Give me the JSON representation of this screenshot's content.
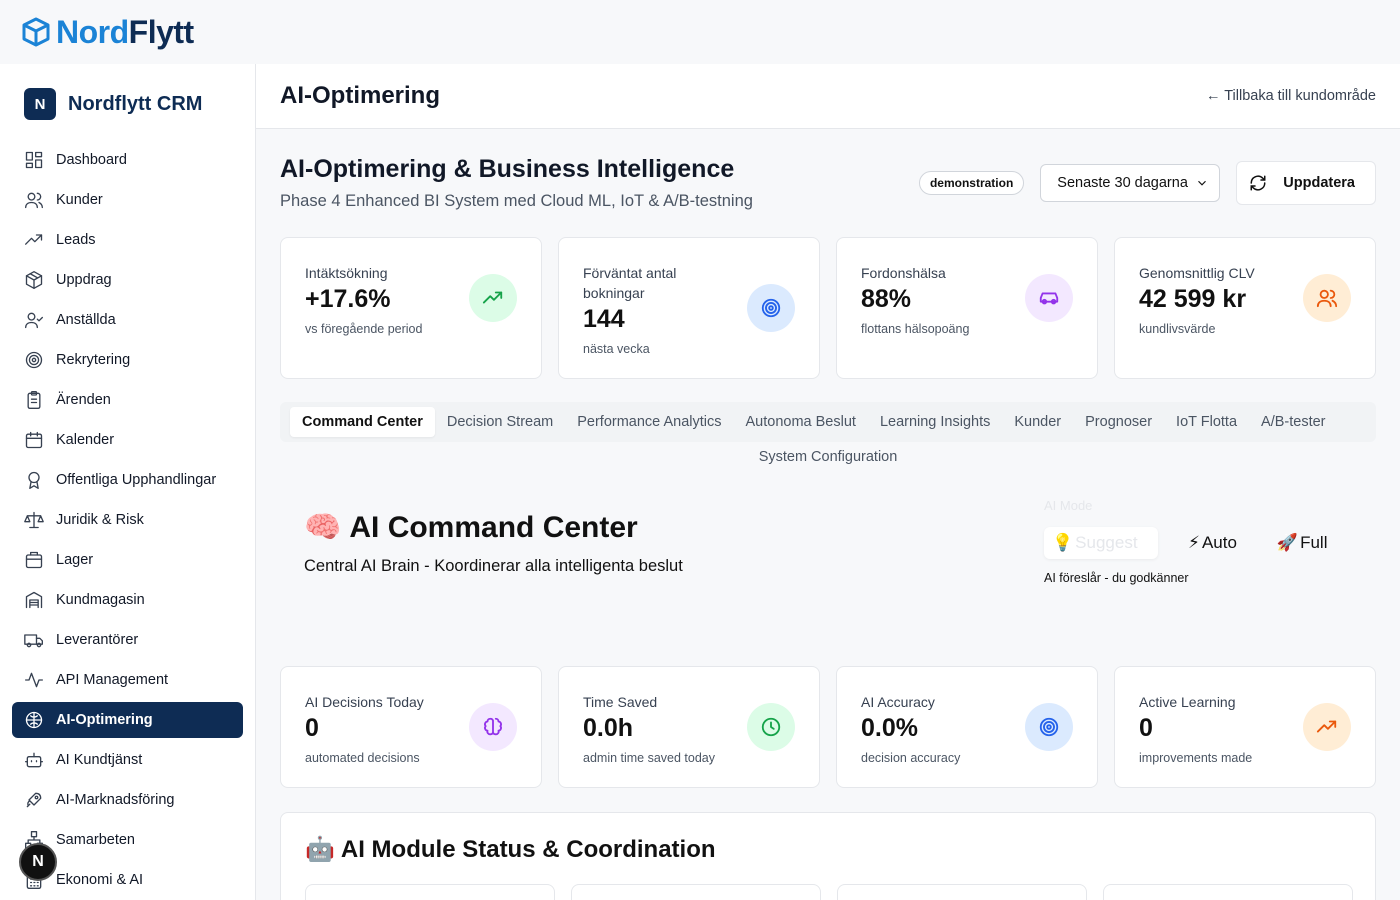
{
  "brand": {
    "part1": "Nord",
    "part2": "Flytt"
  },
  "sidebar": {
    "logo_letter": "N",
    "title": "Nordflytt CRM",
    "items": [
      {
        "label": "Dashboard",
        "icon": "dashboard-icon"
      },
      {
        "label": "Kunder",
        "icon": "users-icon"
      },
      {
        "label": "Leads",
        "icon": "trend-icon"
      },
      {
        "label": "Uppdrag",
        "icon": "package-icon"
      },
      {
        "label": "Anställda",
        "icon": "user-check-icon"
      },
      {
        "label": "Rekrytering",
        "icon": "target-icon"
      },
      {
        "label": "Ärenden",
        "icon": "clipboard-icon"
      },
      {
        "label": "Kalender",
        "icon": "calendar-icon"
      },
      {
        "label": "Offentliga Upphandlingar",
        "icon": "award-icon"
      },
      {
        "label": "Juridik & Risk",
        "icon": "scale-icon"
      },
      {
        "label": "Lager",
        "icon": "box-icon"
      },
      {
        "label": "Kundmagasin",
        "icon": "warehouse-icon"
      },
      {
        "label": "Leverantörer",
        "icon": "truck-icon"
      },
      {
        "label": "API Management",
        "icon": "activity-icon"
      },
      {
        "label": "AI-Optimering",
        "icon": "globe-brain-icon",
        "active": true
      },
      {
        "label": "AI Kundtjänst",
        "icon": "bot-icon"
      },
      {
        "label": "AI-Marknadsföring",
        "icon": "rocket-icon"
      },
      {
        "label": "Samarbeten",
        "icon": "network-icon"
      },
      {
        "label": "Ekonomi & AI",
        "icon": "calculator-icon"
      }
    ]
  },
  "next_badge": "N",
  "header": {
    "title": "AI-Optimering",
    "back_link": "← Tillbaka till kundområde"
  },
  "bi": {
    "title": "AI-Optimering & Business Intelligence",
    "subtitle": "Phase 4 Enhanced BI System med Cloud ML, IoT & A/B-testning",
    "badge": "demonstration",
    "period_select": "Senaste 30 dagarna",
    "refresh_button": "Uppdatera"
  },
  "kpis": [
    {
      "label": "Intäktsökning",
      "value": "+17.6%",
      "sub": "vs föregående period",
      "icon": "trending-up-icon",
      "bg": "#dcfce7",
      "fg": "#16a34a"
    },
    {
      "label": "Förväntat antal bokningar",
      "value": "144",
      "sub": "nästa vecka",
      "icon": "target-icon",
      "bg": "#dbeafe",
      "fg": "#2563eb"
    },
    {
      "label": "Fordonshälsa",
      "value": "88%",
      "sub": "flottans hälsopoäng",
      "icon": "car-icon",
      "bg": "#f3e8ff",
      "fg": "#9333ea"
    },
    {
      "label": "Genomsnittlig CLV",
      "value": "42 599 kr",
      "sub": "kundlivsvärde",
      "icon": "users-icon",
      "bg": "#ffedd5",
      "fg": "#ea580c"
    }
  ],
  "tabs": [
    "Command Center",
    "Decision Stream",
    "Performance Analytics",
    "Autonoma Beslut",
    "Learning Insights",
    "Kunder",
    "Prognoser",
    "IoT Flotta",
    "A/B-tester"
  ],
  "tab_extra": "System Configuration",
  "command": {
    "emoji": "🧠",
    "title": "AI Command Center",
    "subtitle": "Central AI Brain - Koordinerar alla intelligenta beslut",
    "mode_label": "AI Mode",
    "modes": [
      {
        "emoji": "💡",
        "label": "Suggest"
      },
      {
        "emoji": "⚡",
        "label": "Auto"
      },
      {
        "emoji": "🚀",
        "label": "Full"
      }
    ],
    "mode_desc": "AI föreslår - du godkänner"
  },
  "ai_kpis": [
    {
      "label": "AI Decisions Today",
      "value": "0",
      "sub": "automated decisions",
      "icon": "brain-icon",
      "bg": "#f3e8ff",
      "fg": "#9333ea"
    },
    {
      "label": "Time Saved",
      "value": "0.0h",
      "sub": "admin time saved today",
      "icon": "clock-icon",
      "bg": "#dcfce7",
      "fg": "#16a34a"
    },
    {
      "label": "AI Accuracy",
      "value": "0.0%",
      "sub": "decision accuracy",
      "icon": "target-icon",
      "bg": "#dbeafe",
      "fg": "#2563eb"
    },
    {
      "label": "Active Learning",
      "value": "0",
      "sub": "improvements made",
      "icon": "trending-up-icon",
      "bg": "#ffedd5",
      "fg": "#ea580c"
    }
  ],
  "module_status": {
    "emoji": "🤖",
    "title": "AI Module Status & Coordination"
  }
}
